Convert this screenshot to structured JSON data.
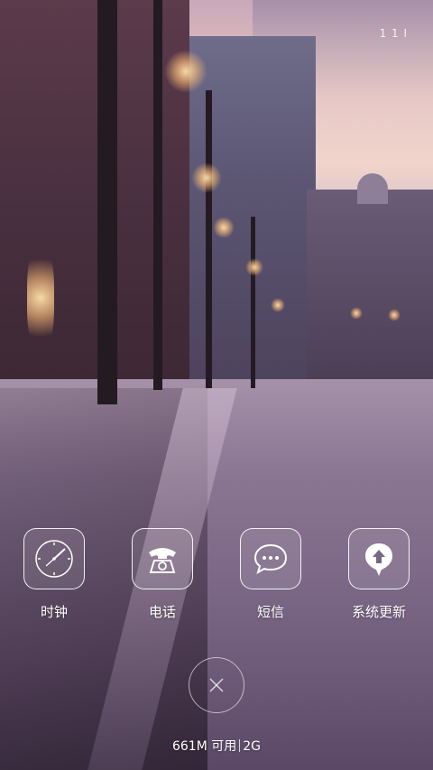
{
  "status_bar": {
    "indicator_text": "1 1 I"
  },
  "recent_apps": [
    {
      "label": "时钟",
      "icon": "clock-icon"
    },
    {
      "label": "电话",
      "icon": "phone-icon"
    },
    {
      "label": "短信",
      "icon": "message-icon"
    },
    {
      "label": "系统更新",
      "icon": "system-update-icon"
    }
  ],
  "clear_button": {
    "icon": "close-icon"
  },
  "memory": {
    "available": "661M 可用",
    "total": "2G"
  }
}
